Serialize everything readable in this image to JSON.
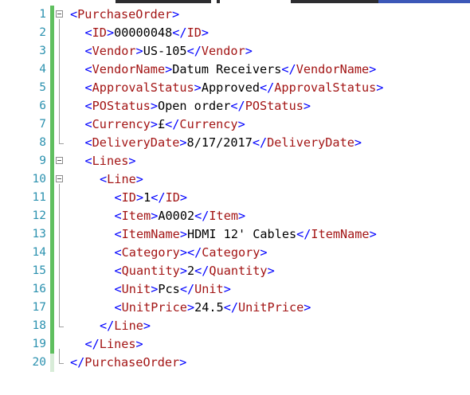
{
  "colors": {
    "line_number": "#2b91af",
    "bracket": "#0000ff",
    "tag_name": "#a31515",
    "text": "#000000",
    "change_bar": "#5fbf5f"
  },
  "lines": [
    {
      "n": "1",
      "indent": 0,
      "fold": true,
      "parts": [
        [
          "br",
          "<"
        ],
        [
          "tag",
          "PurchaseOrder"
        ],
        [
          "br",
          ">"
        ]
      ]
    },
    {
      "n": "2",
      "indent": 1,
      "fold": false,
      "parts": [
        [
          "br",
          "<"
        ],
        [
          "tag",
          "ID"
        ],
        [
          "br",
          ">"
        ],
        [
          "txt",
          "00000048"
        ],
        [
          "br",
          "</"
        ],
        [
          "tag",
          "ID"
        ],
        [
          "br",
          ">"
        ]
      ]
    },
    {
      "n": "3",
      "indent": 1,
      "fold": false,
      "parts": [
        [
          "br",
          "<"
        ],
        [
          "tag",
          "Vendor"
        ],
        [
          "br",
          ">"
        ],
        [
          "txt",
          "US-105"
        ],
        [
          "br",
          "</"
        ],
        [
          "tag",
          "Vendor"
        ],
        [
          "br",
          ">"
        ]
      ]
    },
    {
      "n": "4",
      "indent": 1,
      "fold": false,
      "parts": [
        [
          "br",
          "<"
        ],
        [
          "tag",
          "VendorName"
        ],
        [
          "br",
          ">"
        ],
        [
          "txt",
          "Datum Receivers"
        ],
        [
          "br",
          "</"
        ],
        [
          "tag",
          "VendorName"
        ],
        [
          "br",
          ">"
        ]
      ]
    },
    {
      "n": "5",
      "indent": 1,
      "fold": false,
      "parts": [
        [
          "br",
          "<"
        ],
        [
          "tag",
          "ApprovalStatus"
        ],
        [
          "br",
          ">"
        ],
        [
          "txt",
          "Approved"
        ],
        [
          "br",
          "</"
        ],
        [
          "tag",
          "ApprovalStatus"
        ],
        [
          "br",
          ">"
        ]
      ]
    },
    {
      "n": "6",
      "indent": 1,
      "fold": false,
      "parts": [
        [
          "br",
          "<"
        ],
        [
          "tag",
          "POStatus"
        ],
        [
          "br",
          ">"
        ],
        [
          "txt",
          "Open order"
        ],
        [
          "br",
          "</"
        ],
        [
          "tag",
          "POStatus"
        ],
        [
          "br",
          ">"
        ]
      ]
    },
    {
      "n": "7",
      "indent": 1,
      "fold": false,
      "parts": [
        [
          "br",
          "<"
        ],
        [
          "tag",
          "Currency"
        ],
        [
          "br",
          ">"
        ],
        [
          "txt",
          "£"
        ],
        [
          "br",
          "</"
        ],
        [
          "tag",
          "Currency"
        ],
        [
          "br",
          ">"
        ]
      ]
    },
    {
      "n": "8",
      "indent": 1,
      "fold": false,
      "parts": [
        [
          "br",
          "<"
        ],
        [
          "tag",
          "DeliveryDate"
        ],
        [
          "br",
          ">"
        ],
        [
          "txt",
          "8/17/2017"
        ],
        [
          "br",
          "</"
        ],
        [
          "tag",
          "DeliveryDate"
        ],
        [
          "br",
          ">"
        ]
      ]
    },
    {
      "n": "9",
      "indent": 1,
      "fold": true,
      "parts": [
        [
          "br",
          "<"
        ],
        [
          "tag",
          "Lines"
        ],
        [
          "br",
          ">"
        ]
      ]
    },
    {
      "n": "10",
      "indent": 2,
      "fold": true,
      "parts": [
        [
          "br",
          "<"
        ],
        [
          "tag",
          "Line"
        ],
        [
          "br",
          ">"
        ]
      ]
    },
    {
      "n": "11",
      "indent": 3,
      "fold": false,
      "parts": [
        [
          "br",
          "<"
        ],
        [
          "tag",
          "ID"
        ],
        [
          "br",
          ">"
        ],
        [
          "txt",
          "1"
        ],
        [
          "br",
          "</"
        ],
        [
          "tag",
          "ID"
        ],
        [
          "br",
          ">"
        ]
      ]
    },
    {
      "n": "12",
      "indent": 3,
      "fold": false,
      "parts": [
        [
          "br",
          "<"
        ],
        [
          "tag",
          "Item"
        ],
        [
          "br",
          ">"
        ],
        [
          "txt",
          "A0002"
        ],
        [
          "br",
          "</"
        ],
        [
          "tag",
          "Item"
        ],
        [
          "br",
          ">"
        ]
      ]
    },
    {
      "n": "13",
      "indent": 3,
      "fold": false,
      "parts": [
        [
          "br",
          "<"
        ],
        [
          "tag",
          "ItemName"
        ],
        [
          "br",
          ">"
        ],
        [
          "txt",
          "HDMI 12' Cables"
        ],
        [
          "br",
          "</"
        ],
        [
          "tag",
          "ItemName"
        ],
        [
          "br",
          ">"
        ]
      ]
    },
    {
      "n": "14",
      "indent": 3,
      "fold": false,
      "parts": [
        [
          "br",
          "<"
        ],
        [
          "tag",
          "Category"
        ],
        [
          "br",
          "></"
        ],
        [
          "tag",
          "Category"
        ],
        [
          "br",
          ">"
        ]
      ]
    },
    {
      "n": "15",
      "indent": 3,
      "fold": false,
      "parts": [
        [
          "br",
          "<"
        ],
        [
          "tag",
          "Quantity"
        ],
        [
          "br",
          ">"
        ],
        [
          "txt",
          "2"
        ],
        [
          "br",
          "</"
        ],
        [
          "tag",
          "Quantity"
        ],
        [
          "br",
          ">"
        ]
      ]
    },
    {
      "n": "16",
      "indent": 3,
      "fold": false,
      "parts": [
        [
          "br",
          "<"
        ],
        [
          "tag",
          "Unit"
        ],
        [
          "br",
          ">"
        ],
        [
          "txt",
          "Pcs"
        ],
        [
          "br",
          "</"
        ],
        [
          "tag",
          "Unit"
        ],
        [
          "br",
          ">"
        ]
      ]
    },
    {
      "n": "17",
      "indent": 3,
      "fold": false,
      "parts": [
        [
          "br",
          "<"
        ],
        [
          "tag",
          "UnitPrice"
        ],
        [
          "br",
          ">"
        ],
        [
          "txt",
          "24.5"
        ],
        [
          "br",
          "</"
        ],
        [
          "tag",
          "UnitPrice"
        ],
        [
          "br",
          ">"
        ]
      ]
    },
    {
      "n": "18",
      "indent": 2,
      "fold": false,
      "parts": [
        [
          "br",
          "</"
        ],
        [
          "tag",
          "Line"
        ],
        [
          "br",
          ">"
        ]
      ]
    },
    {
      "n": "19",
      "indent": 1,
      "fold": false,
      "parts": [
        [
          "br",
          "</"
        ],
        [
          "tag",
          "Lines"
        ],
        [
          "br",
          ">"
        ]
      ]
    },
    {
      "n": "20",
      "indent": 0,
      "fold": false,
      "parts": [
        [
          "br",
          "</"
        ],
        [
          "tag",
          "PurchaseOrder"
        ],
        [
          "br",
          ">"
        ]
      ]
    }
  ]
}
